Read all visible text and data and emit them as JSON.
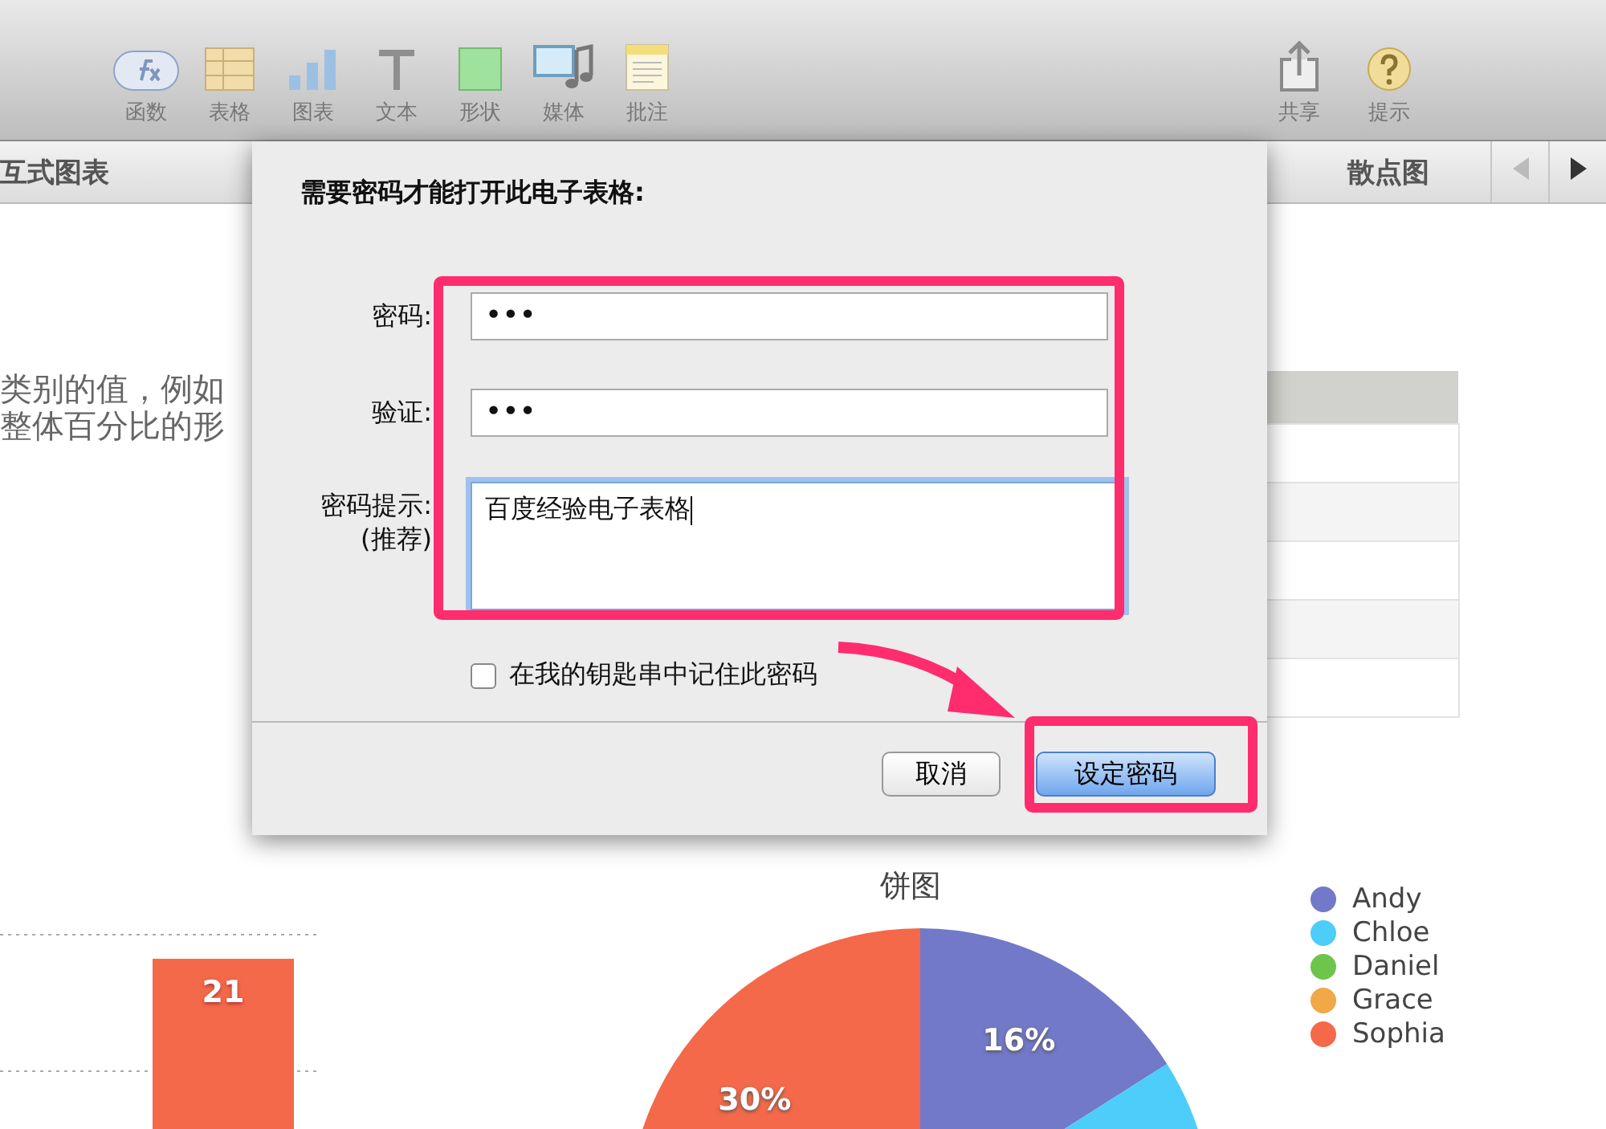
{
  "toolbar": {
    "left_tools": [
      {
        "label": "函数",
        "kind": "function"
      },
      {
        "label": "表格",
        "kind": "table"
      },
      {
        "label": "图表",
        "kind": "chart"
      },
      {
        "label": "文本",
        "kind": "text"
      },
      {
        "label": "形状",
        "kind": "shape"
      },
      {
        "label": "媒体",
        "kind": "media"
      },
      {
        "label": "批注",
        "kind": "comment"
      }
    ],
    "right_tools": [
      {
        "label": "共享",
        "kind": "share"
      },
      {
        "label": "提示",
        "kind": "tips"
      }
    ]
  },
  "sheet_tabs": {
    "tabs": [
      {
        "label": "互式图表"
      },
      {
        "label": "散点图"
      }
    ],
    "previous": {
      "disabled": true
    },
    "next": {
      "disabled": false
    }
  },
  "content": {
    "intro_lines": [
      "类别的值，例如",
      "整体百分比的形"
    ],
    "bar_chart": {
      "bar_label": "21"
    },
    "pie_chart": {
      "title": "饼图",
      "items": [
        {
          "name": "Andy",
          "color": "#7279c8",
          "slice_label": "16%"
        },
        {
          "name": "Chloe",
          "color": "#4dcdf9"
        },
        {
          "name": "Daniel",
          "color": "#6dc54c"
        },
        {
          "name": "Grace",
          "color": "#f1a847"
        },
        {
          "name": "Sophia",
          "color": "#f4694a",
          "slice_label": "30%"
        }
      ]
    }
  },
  "dialog": {
    "title": "需要密码才能打开此电子表格:",
    "fields": [
      {
        "label": "密码:",
        "value": "•••",
        "kind": "password",
        "focused": false
      },
      {
        "label": "验证:",
        "value": "•••",
        "kind": "password",
        "focused": false
      },
      {
        "label": "密码提示:",
        "sublabel": "(推荐)",
        "value": "百度经验电子表格",
        "kind": "textarea",
        "focused": true
      }
    ],
    "remember": {
      "label": "在我的钥匙串中记住此密码",
      "checked": false
    },
    "buttons": [
      {
        "label": "取消",
        "default": false
      },
      {
        "label": "设定密码",
        "default": true
      }
    ]
  }
}
